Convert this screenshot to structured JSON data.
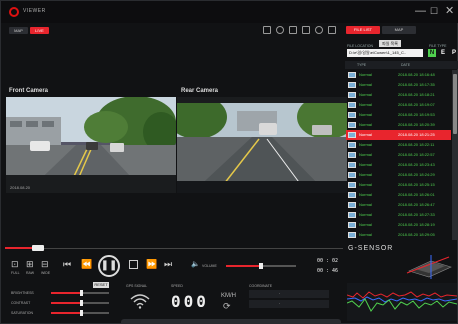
{
  "app": {
    "name": "VIEWER"
  },
  "window": {
    "min": "—",
    "max": "☐",
    "close": "✕"
  },
  "modes": {
    "map": "MAP",
    "live": "LIVE"
  },
  "tabs": {
    "file_list": "FILE LIST",
    "map": "MAP"
  },
  "videos": {
    "front_label": "Front Camera",
    "rear_label": "Rear Camera"
  },
  "side": {
    "file_location_label": "FILE LOCATION",
    "folder_button": "파일 목록",
    "path": "D:\\e\\일\\일일\\e\\Cuwen\\1_145_C..",
    "file_type_label": "FILE TYPE",
    "file_types": [
      "N",
      "E",
      "P"
    ],
    "col_type": "TYPE",
    "col_date": "DATE",
    "rows": [
      {
        "type": "Normal",
        "date": "2018.08.20 18:16:48"
      },
      {
        "type": "Normal",
        "date": "2018.08.20 18:17:35"
      },
      {
        "type": "Normal",
        "date": "2018.08.20 18:18:21"
      },
      {
        "type": "Normal",
        "date": "2018.08.20 18:19:07"
      },
      {
        "type": "Normal",
        "date": "2018.08.20 18:19:53"
      },
      {
        "type": "Normal",
        "date": "2018.08.20 18:20:39"
      },
      {
        "type": "Normal",
        "date": "2018.08.20 18:21:25"
      },
      {
        "type": "Normal",
        "date": "2018.08.20 18:22:11"
      },
      {
        "type": "Normal",
        "date": "2018.08.20 18:22:57"
      },
      {
        "type": "Normal",
        "date": "2018.08.20 18:23:43"
      },
      {
        "type": "Normal",
        "date": "2018.08.20 18:24:29"
      },
      {
        "type": "Normal",
        "date": "2018.08.20 18:25:15"
      },
      {
        "type": "Normal",
        "date": "2018.08.20 18:26:01"
      },
      {
        "type": "Normal",
        "date": "2018.08.20 18:26:47"
      },
      {
        "type": "Normal",
        "date": "2018.08.20 18:27:33"
      },
      {
        "type": "Normal",
        "date": "2018.08.20 18:28:19"
      },
      {
        "type": "Normal",
        "date": "2018.08.20 18:29:05"
      },
      {
        "type": "Normal",
        "date": "2018.08.20 18:29:51"
      }
    ],
    "selected_row": 6
  },
  "player": {
    "screen_labels": [
      "FULL",
      "RAW",
      "WIDE"
    ],
    "volume_label": "VOLUME",
    "time_current": "00 : 02",
    "time_total": "00 : 46",
    "progress_fraction": 0.08,
    "volume_fraction": 0.5
  },
  "adjust": {
    "reset": "RESET",
    "brightness": "BRIGHTNESS",
    "contrast": "CONTRAST",
    "saturation": "SATURATION"
  },
  "gps": {
    "label": "GPS SIGNAL"
  },
  "speed": {
    "label": "SPEED",
    "value": "000",
    "unit": "KM/H"
  },
  "coords": {
    "label": "COORDINATE",
    "lat": "-",
    "lon": "-"
  },
  "gsensor": {
    "title": "G-SENSOR"
  },
  "colors": {
    "accent": "#e8252d",
    "green": "#4fd04f"
  }
}
